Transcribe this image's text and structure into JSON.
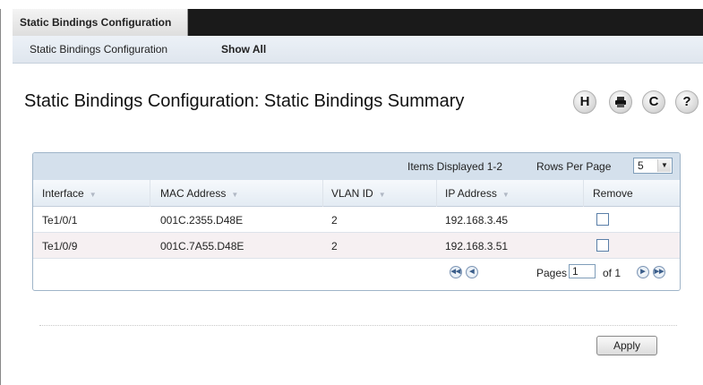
{
  "top_tab": {
    "label": "Static Bindings Configuration"
  },
  "subnav": {
    "items": [
      {
        "label": "Static Bindings Configuration"
      },
      {
        "label": "Show All"
      }
    ]
  },
  "page_title": "Static Bindings Configuration: Static Bindings Summary",
  "icons": [
    "save-icon",
    "print-icon",
    "refresh-icon",
    "help-icon"
  ],
  "icon_glyphs": {
    "save": "H",
    "refresh": "C",
    "help": "?"
  },
  "table": {
    "items_displayed": "Items Displayed 1-2",
    "rows_per_page_label": "Rows Per Page",
    "rows_per_page_value": "5",
    "columns": [
      "Interface",
      "MAC Address",
      "VLAN ID",
      "IP Address",
      "Remove"
    ],
    "rows": [
      {
        "interface": "Te1/0/1",
        "mac": "001C.2355.D48E",
        "vlan": "2",
        "ip": "192.168.3.45",
        "remove": false
      },
      {
        "interface": "Te1/0/9",
        "mac": "001C.7A55.D48E",
        "vlan": "2",
        "ip": "192.168.3.51",
        "remove": false
      }
    ],
    "pager": {
      "pages_label": "Pages",
      "page_value": "1",
      "of_label": "of 1"
    }
  },
  "apply_label": "Apply"
}
